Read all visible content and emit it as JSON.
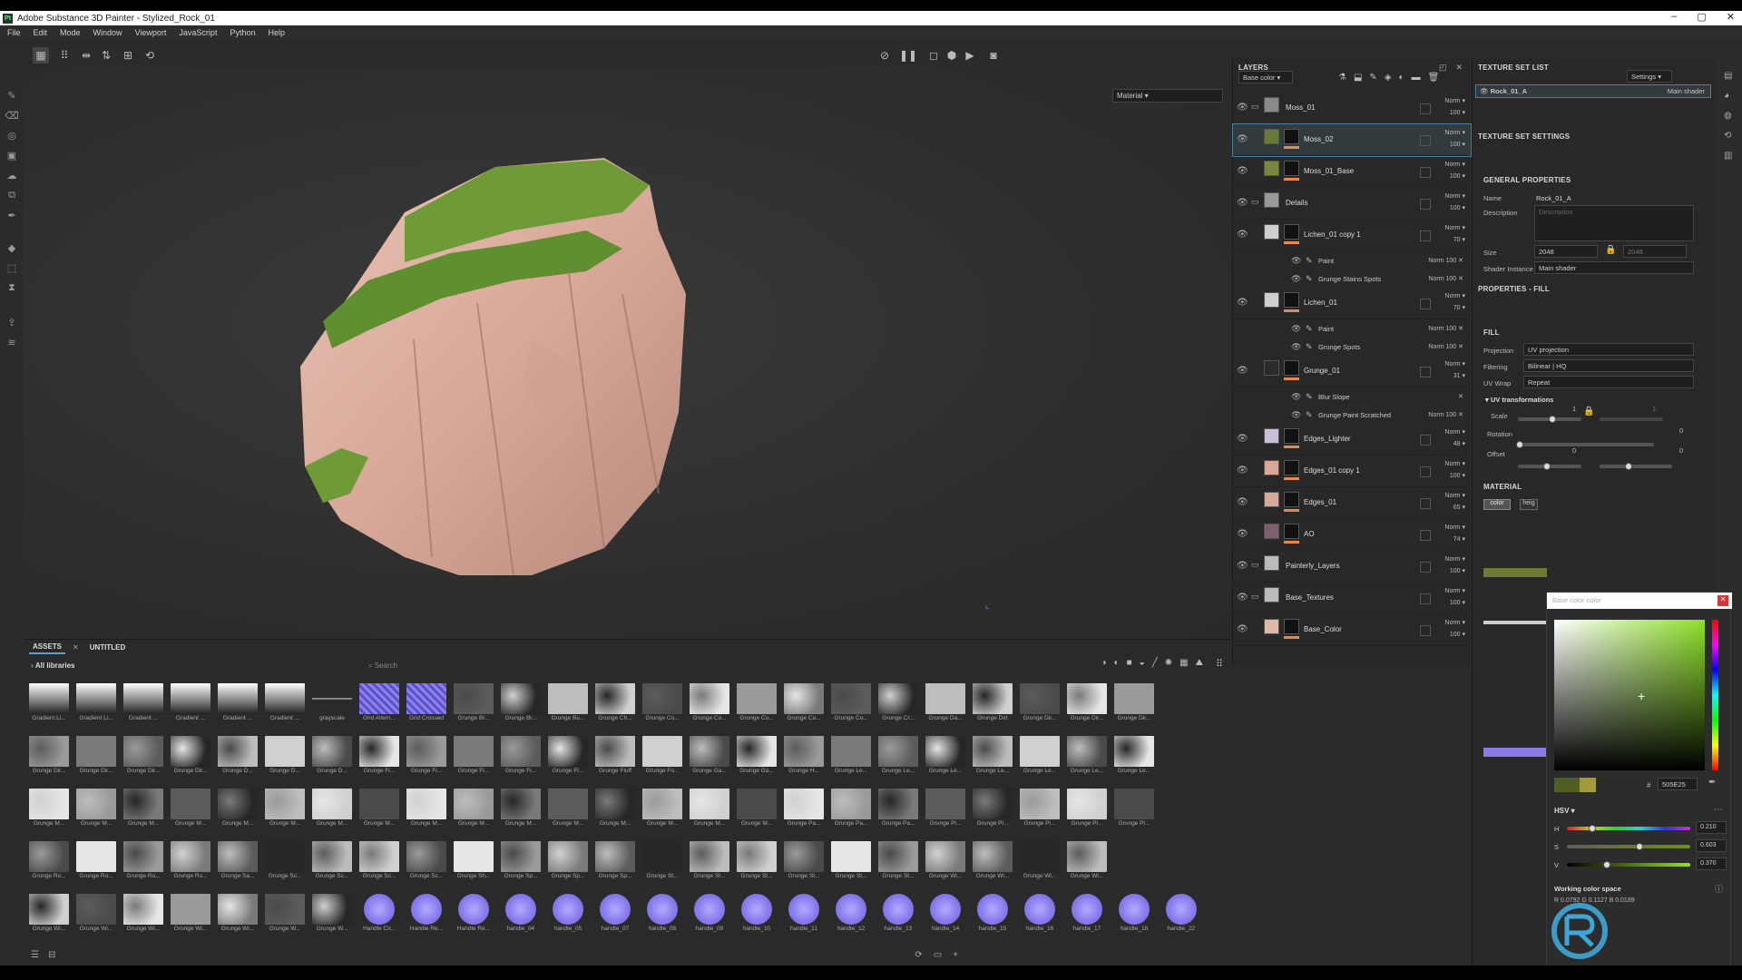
{
  "app": {
    "title": "Adobe Substance 3D Painter - Stylized_Rock_01"
  },
  "menu": [
    "File",
    "Edit",
    "Mode",
    "Window",
    "Viewport",
    "JavaScript",
    "Python",
    "Help"
  ],
  "viewport": {
    "material_mode": "Material"
  },
  "layers_panel": {
    "title": "LAYERS",
    "channel": "Base color",
    "layers": [
      {
        "name": "Moss_01",
        "blend": "Norm",
        "opacity": "100",
        "type": "folder"
      },
      {
        "name": "Moss_02",
        "blend": "Norm",
        "opacity": "100",
        "type": "fill",
        "selected": true
      },
      {
        "name": "Moss_01_Base",
        "blend": "Norm",
        "opacity": "100",
        "type": "fill"
      },
      {
        "name": "Details",
        "blend": "Norm",
        "opacity": "100",
        "type": "folder"
      },
      {
        "name": "Lichen_01 copy 1",
        "blend": "Norm",
        "opacity": "70",
        "type": "fill",
        "effects": [
          {
            "name": "Paint",
            "blend": "Norm",
            "opacity": "100"
          },
          {
            "name": "Grunge Stains Spots",
            "blend": "Norm",
            "opacity": "100"
          }
        ]
      },
      {
        "name": "Lichen_01",
        "blend": "Norm",
        "opacity": "70",
        "type": "fill",
        "effects": [
          {
            "name": "Paint",
            "blend": "Norm",
            "opacity": "100"
          },
          {
            "name": "Grunge Spots",
            "blend": "Norm",
            "opacity": "100"
          }
        ]
      },
      {
        "name": "Grunge_01",
        "blend": "Norm",
        "opacity": "31",
        "type": "fill",
        "effects": [
          {
            "name": "Blur Slope",
            "blend": "",
            "opacity": ""
          },
          {
            "name": "Grunge Paint Scratched",
            "blend": "Norm",
            "opacity": "100"
          }
        ]
      },
      {
        "name": "Edges_Lighter",
        "blend": "Norm",
        "opacity": "48",
        "type": "fill"
      },
      {
        "name": "Edges_01 copy 1",
        "blend": "Norm",
        "opacity": "100",
        "type": "fill"
      },
      {
        "name": "Edges_01",
        "blend": "Norm",
        "opacity": "65",
        "type": "fill"
      },
      {
        "name": "AO",
        "blend": "Norm",
        "opacity": "74",
        "type": "fill"
      },
      {
        "name": "Painterly_Layers",
        "blend": "Norm",
        "opacity": "100",
        "type": "folder"
      },
      {
        "name": "Base_Textures",
        "blend": "Norm",
        "opacity": "100",
        "type": "folder"
      },
      {
        "name": "Base_Color",
        "blend": "Norm",
        "opacity": "100",
        "type": "fill"
      }
    ]
  },
  "texture_set_list": {
    "title": "TEXTURE SET LIST",
    "settings_label": "Settings",
    "item": "Rock_01_A",
    "shader": "Main shader"
  },
  "texture_set_settings": {
    "title": "TEXTURE SET SETTINGS",
    "section": "GENERAL PROPERTIES",
    "name_label": "Name",
    "name_value": "Rock_01_A",
    "desc_label": "Description",
    "desc_placeholder": "Description",
    "size_label": "Size",
    "size_value": "2048",
    "size_value2": "2048",
    "shader_label": "Shader Instance",
    "shader_value": "Main shader"
  },
  "properties_fill": {
    "title": "PROPERTIES - FILL",
    "section": "FILL",
    "projection_label": "Projection",
    "projection_value": "UV projection",
    "filtering_label": "Filtering",
    "filtering_value": "Bilinear | HQ",
    "uvwrap_label": "UV Wrap",
    "uvwrap_value": "Repeat",
    "uvt_label": "UV transformations",
    "scale_label": "Scale",
    "scale_value": "1",
    "scale_value2": "1",
    "rotation_label": "Rotation",
    "rotation_value": "0",
    "offset_label": "Offset",
    "offset_value": "0",
    "offset_value2": "0",
    "material_label": "MATERIAL",
    "color_btn": "color",
    "height_btn": "heig"
  },
  "color_picker": {
    "placeholder": "Base color color",
    "hash": "#",
    "hex": "505E25",
    "mode": "HSV",
    "h_label": "H",
    "h_value": "0.210",
    "s_label": "S",
    "s_value": "0.603",
    "v_label": "V",
    "v_value": "0.370",
    "wcs_label": "Working color space",
    "rgb": "R 0.0792  G 0.1127  B 0.0189",
    "colors": {
      "current": "#505e25",
      "previous": "#a39a3a"
    }
  },
  "assets": {
    "tabs": [
      "ASSETS",
      "UNTITLED"
    ],
    "library": "All libraries",
    "search_placeholder": "Search",
    "rows": [
      [
        "Gradient Li...",
        "Gradient Li...",
        "Gradient ...",
        "Gradient ...",
        "Gradient ...",
        "Gradient ...",
        "grayscale",
        "Grid Altern...",
        "Grid Crossed",
        "Grunge Br...",
        "Grunge Br...",
        "Grunge Bu...",
        "Grunge Ch...",
        "Grunge Co...",
        "Grunge Co...",
        "Grunge Co...",
        "Grunge Co...",
        "Grunge Co...",
        "Grunge Cr...",
        "Grunge Da...",
        "Grunge Dirt",
        "Grunge Dir...",
        "Grunge Dir...",
        "Grunge Dir..."
      ],
      [
        "Grunge Dir...",
        "Grunge Dir...",
        "Grunge Dir...",
        "Grunge Dir...",
        "Grunge D...",
        "Grunge D...",
        "Grunge D...",
        "Grunge Fi...",
        "Grunge Fi...",
        "Grunge Fi...",
        "Grunge Fi...",
        "Grunge Fl...",
        "Grunge Fluff",
        "Grunge Fo...",
        "Grunge Ga...",
        "Grunge Ga...",
        "Grunge H...",
        "Grunge Le...",
        "Grunge Le...",
        "Grunge Le...",
        "Grunge Le...",
        "Grunge Le...",
        "Grunge Le...",
        "Grunge Le..."
      ],
      [
        "Grunge M...",
        "Grunge M...",
        "Grunge M...",
        "Grunge M...",
        "Grunge M...",
        "Grunge M...",
        "Grunge M...",
        "Grunge M...",
        "Grunge M...",
        "Grunge M...",
        "Grunge M...",
        "Grunge M...",
        "Grunge M...",
        "Grunge M...",
        "Grunge M...",
        "Grunge M...",
        "Grunge Pa...",
        "Grunge Pa...",
        "Grunge Pa...",
        "Grunge Pl...",
        "Grunge Pl...",
        "Grunge Pl...",
        "Grunge Pl...",
        "Grunge Pl..."
      ],
      [
        "Grunge Ro...",
        "Grunge Ro...",
        "Grunge Ro...",
        "Grunge Ru...",
        "Grunge Sa...",
        "Grunge Sc...",
        "Grunge Sc...",
        "Grunge Sc...",
        "Grunge Sc...",
        "Grunge Sh...",
        "Grunge Sp...",
        "Grunge Sp...",
        "Grunge Sp...",
        "Grunge St...",
        "Grunge St...",
        "Grunge St...",
        "Grunge St...",
        "Grunge St...",
        "Grunge St...",
        "Grunge Wi...",
        "Grunge Wi...",
        "Grunge Wi...",
        "Grunge Wi..."
      ],
      [
        "Grunge Wi...",
        "Grunge Wi...",
        "Grunge Wi...",
        "Grunge Wi...",
        "Grunge Wi...",
        "Grunge W...",
        "Grunge W...",
        "Handle Cir...",
        "Handle Re...",
        "Handle Re...",
        "handle_04",
        "handle_05",
        "handle_07",
        "handle_08",
        "handle_09",
        "handle_10",
        "handle_11",
        "handle_12",
        "handle_13",
        "handle_14",
        "handle_15",
        "handle_16",
        "handle_17",
        "handle_18",
        "handle_22"
      ]
    ]
  }
}
